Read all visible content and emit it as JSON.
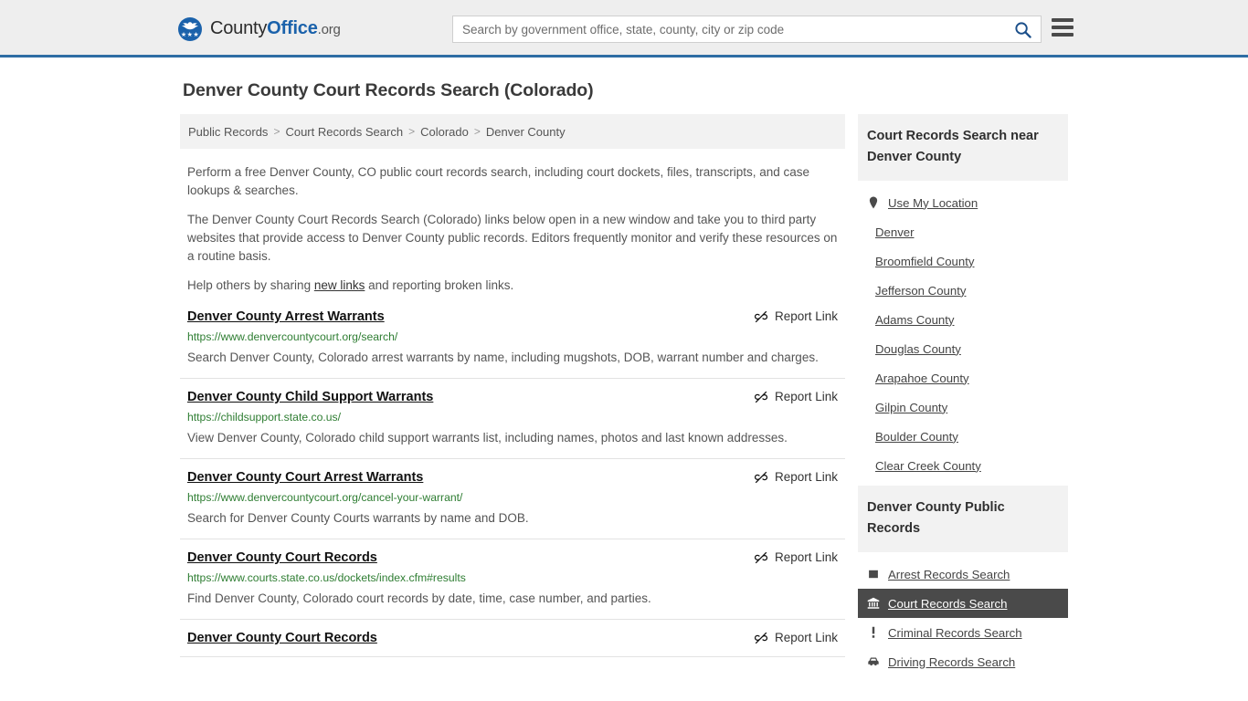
{
  "header": {
    "brand": {
      "part1": "County",
      "part2": "Office",
      "part3": ".org"
    },
    "search": {
      "placeholder": "Search by government office, state, county, city or zip code",
      "value": ""
    },
    "search_icon": "search-icon",
    "menu_icon": "hamburger-menu-icon"
  },
  "page": {
    "title": "Denver County Court Records Search (Colorado)"
  },
  "breadcrumb": {
    "separator": ">",
    "items": [
      {
        "label": "Public Records",
        "current": false
      },
      {
        "label": "Court Records Search",
        "current": false
      },
      {
        "label": "Colorado",
        "current": false
      },
      {
        "label": "Denver County",
        "current": true
      }
    ]
  },
  "intro": {
    "p1": "Perform a free Denver County, CO public court records search, including court dockets, files, transcripts, and case lookups & searches.",
    "p2": "The Denver County Court Records Search (Colorado) links below open in a new window and take you to third party websites that provide access to Denver County public records. Editors frequently monitor and verify these resources on a routine basis.",
    "p3_before": "Help others by sharing ",
    "p3_link": "new links",
    "p3_after": " and reporting broken links."
  },
  "results": {
    "report_label": "Report Link",
    "report_icon": "broken-link-icon",
    "items": [
      {
        "title": "Denver County Arrest Warrants",
        "url": "https://www.denvercountycourt.org/search/",
        "description": "Search Denver County, Colorado arrest warrants by name, including mugshots, DOB, warrant number and charges."
      },
      {
        "title": "Denver County Child Support Warrants",
        "url": "https://childsupport.state.co.us/",
        "description": "View Denver County, Colorado child support warrants list, including names, photos and last known addresses."
      },
      {
        "title": "Denver County Court Arrest Warrants",
        "url": "https://www.denvercountycourt.org/cancel-your-warrant/",
        "description": "Search for Denver County Courts warrants by name and DOB."
      },
      {
        "title": "Denver County Court Records",
        "url": "https://www.courts.state.co.us/dockets/index.cfm#results",
        "description": "Find Denver County, Colorado court records by date, time, case number, and parties."
      },
      {
        "title": "Denver County Court Records",
        "url": "",
        "description": ""
      }
    ]
  },
  "sidebar": {
    "nearby": {
      "heading": "Court Records Search near Denver County",
      "items": [
        {
          "label": "Use My Location",
          "icon": "map-pin-icon",
          "active": false
        },
        {
          "label": "Denver",
          "icon": "",
          "active": false
        },
        {
          "label": "Broomfield County",
          "icon": "",
          "active": false
        },
        {
          "label": "Jefferson County",
          "icon": "",
          "active": false
        },
        {
          "label": "Adams County",
          "icon": "",
          "active": false
        },
        {
          "label": "Douglas County",
          "icon": "",
          "active": false
        },
        {
          "label": "Arapahoe County",
          "icon": "",
          "active": false
        },
        {
          "label": "Gilpin County",
          "icon": "",
          "active": false
        },
        {
          "label": "Boulder County",
          "icon": "",
          "active": false
        },
        {
          "label": "Clear Creek County",
          "icon": "",
          "active": false
        }
      ]
    },
    "public_records": {
      "heading": "Denver County Public Records",
      "items": [
        {
          "label": "Arrest Records Search",
          "icon": "handcuffs-icon",
          "active": false
        },
        {
          "label": "Court Records Search",
          "icon": "courthouse-icon",
          "active": true
        },
        {
          "label": "Criminal Records Search",
          "icon": "exclamation-icon",
          "active": false
        },
        {
          "label": "Driving Records Search",
          "icon": "car-icon",
          "active": false
        }
      ]
    }
  },
  "colors": {
    "brand_blue": "#1b62ab",
    "header_border": "#2e6da4",
    "header_bg": "#eeeeee",
    "url_green": "#2e7d32",
    "active_bg": "#4a4a4a",
    "panel_bg": "#f2f2f2"
  }
}
